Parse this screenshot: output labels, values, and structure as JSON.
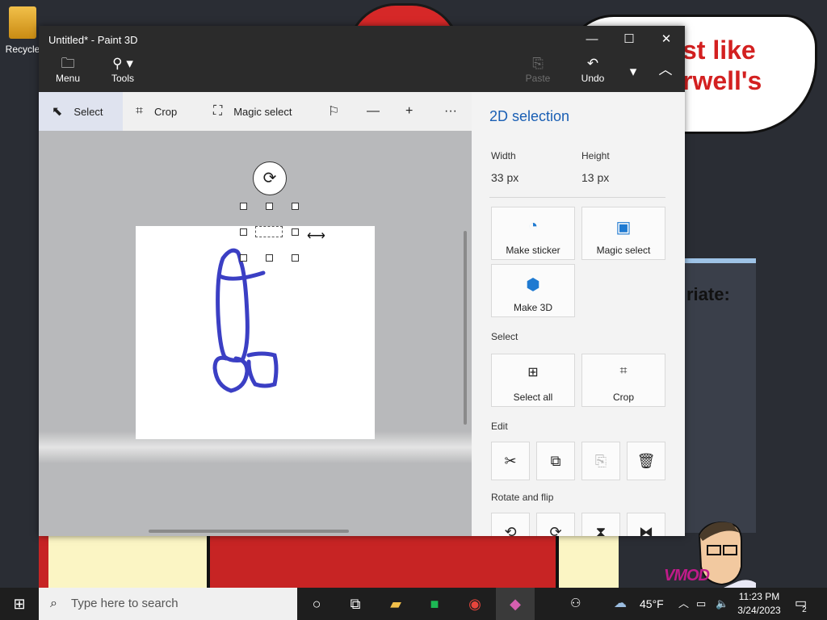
{
  "desktop": {
    "recycle_label": "Recycle",
    "speech_text": "st like\nrwell's",
    "panel_text": "riate:",
    "watermark": "VMOD"
  },
  "window": {
    "title": "Untitled* - Paint 3D",
    "controls": {
      "minimize": "—",
      "maximize": "☐",
      "close": "✕"
    }
  },
  "ribbon": {
    "menu": {
      "label": "Menu",
      "icon": "folder-icon"
    },
    "tools": {
      "label": "Tools",
      "icon": "tools-icon"
    },
    "paste": {
      "label": "Paste",
      "icon": "paste-icon"
    },
    "undo": {
      "label": "Undo",
      "icon": "undo-icon"
    }
  },
  "toolbar": {
    "select": "Select",
    "crop": "Crop",
    "magic_select": "Magic select",
    "more": "···"
  },
  "panel": {
    "title": "2D selection",
    "width_label": "Width",
    "width_value": "33 px",
    "height_label": "Height",
    "height_value": "13 px",
    "actions": [
      {
        "label": "Make sticker",
        "icon": "sticker-icon"
      },
      {
        "label": "Magic select",
        "icon": "magic-select-icon"
      },
      {
        "label": "Make 3D",
        "icon": "cube-icon"
      }
    ],
    "select_section": "Select",
    "select_all": "Select all",
    "crop": "Crop",
    "edit_section": "Edit",
    "rotate_section": "Rotate and flip"
  },
  "taskbar": {
    "search_placeholder": "Type here to search",
    "weather": "45°F",
    "time": "11:23 PM",
    "date": "3/24/2023",
    "notifications": "2"
  },
  "colors": {
    "accent": "#1a5fb4",
    "drawing_stroke": "#3b3fc4",
    "select_highlight": "#dfe3ef"
  }
}
